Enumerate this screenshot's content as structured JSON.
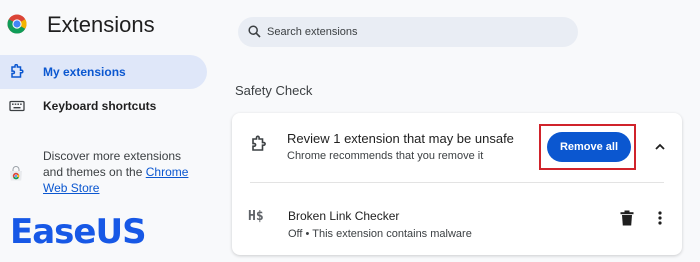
{
  "header": {
    "title": "Extensions",
    "search_placeholder": "Search extensions"
  },
  "sidebar": {
    "items": [
      {
        "label": "My extensions",
        "icon": "puzzle-icon",
        "active": true
      },
      {
        "label": "Keyboard shortcuts",
        "icon": "keyboard-icon",
        "active": false
      }
    ],
    "discover_text": "Discover more extensions and themes on the ",
    "discover_link": "Chrome Web Store"
  },
  "watermark": {
    "text": "EaseUS"
  },
  "safety_check": {
    "title": "Safety Check",
    "heading": "Review 1 extension that may be unsafe",
    "subtext": "Chrome recommends that you remove it",
    "remove_all_label": "Remove all",
    "highlight_color": "#d0232b"
  },
  "extension": {
    "icon_text": "H$",
    "name": "Broken Link Checker",
    "status": "Off • This extension contains malware"
  },
  "colors": {
    "accent": "#0b57d0",
    "active_nav_bg": "#dfe7f9",
    "search_bg": "#e9edf4"
  }
}
